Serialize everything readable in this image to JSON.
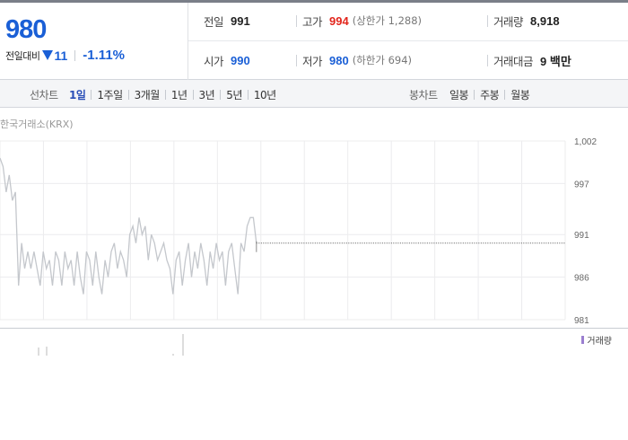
{
  "summary": {
    "price": "980",
    "change_label": "전일대비",
    "change_value": "11",
    "change_pct": "-1.11%",
    "prev_close": {
      "label": "전일",
      "value": "991"
    },
    "high": {
      "label": "고가",
      "value": "994",
      "sub": "(상한가 1,288)"
    },
    "volume": {
      "label": "거래량",
      "value": "8,918"
    },
    "open": {
      "label": "시가",
      "value": "990"
    },
    "low": {
      "label": "저가",
      "value": "980",
      "sub": "(하한가 694)"
    },
    "trade_amount": {
      "label": "거래대금",
      "value": "9 백만"
    }
  },
  "toolbar": {
    "line_label": "선차트",
    "line_periods": [
      "1일",
      "1주일",
      "3개월",
      "1년",
      "3년",
      "5년",
      "10년"
    ],
    "line_active": "1일",
    "candle_label": "봉차트",
    "candle_periods": [
      "일봉",
      "주봉",
      "월봉"
    ]
  },
  "chart": {
    "source_label": "한국거래소(KRX)",
    "volume_legend": "거래량"
  },
  "chart_data": {
    "type": "line",
    "ylim": [
      981,
      1002
    ],
    "y_ticks": [
      "1,002",
      "997",
      "991",
      "986",
      "981"
    ],
    "y_tick_values": [
      1002,
      997,
      991,
      986,
      981
    ],
    "grid": true,
    "session_progress": [
      0,
      0.4537
    ],
    "series": [
      {
        "values": [
          1000,
          999,
          996,
          998,
          995,
          996,
          985,
          990,
          987,
          989,
          987,
          989,
          987,
          985,
          989,
          987,
          988,
          985,
          989,
          988,
          985,
          989,
          987,
          988,
          985,
          989,
          986,
          984,
          989,
          988,
          985,
          989,
          986,
          984,
          988,
          986,
          989,
          990,
          987,
          989,
          988,
          986,
          991,
          992,
          990,
          993,
          991,
          992,
          988,
          991,
          990,
          988,
          989,
          990,
          988,
          987,
          984,
          988,
          989,
          985,
          988,
          990,
          986,
          989,
          987,
          990,
          988,
          985,
          989,
          987,
          990,
          988,
          989,
          985,
          989,
          990,
          987,
          984,
          990,
          989,
          992,
          993,
          993,
          990
        ]
      }
    ],
    "last_value": 990,
    "volume_values": [
      0,
      0,
      0,
      0,
      0,
      0,
      0,
      0,
      0,
      0,
      0,
      0,
      0,
      0,
      0,
      0,
      0,
      0,
      0,
      0,
      0,
      0,
      0,
      0,
      0,
      0,
      0,
      0,
      0,
      0,
      0,
      0,
      0,
      0,
      0,
      0,
      0,
      0,
      0,
      0,
      0,
      0,
      0,
      0,
      0,
      0,
      0,
      0,
      0,
      0,
      0,
      0,
      0,
      0,
      0,
      0,
      0,
      0,
      0,
      0,
      0,
      0,
      0,
      0,
      0,
      0,
      0,
      0,
      0,
      0,
      0,
      0,
      0,
      0,
      0,
      0,
      0,
      0,
      0,
      0,
      0,
      0,
      0,
      0
    ]
  },
  "colors": {
    "down": "#1a5fd6",
    "up": "#e2261c",
    "line": "#c4c7cc",
    "volume": "#9b7fd0"
  }
}
